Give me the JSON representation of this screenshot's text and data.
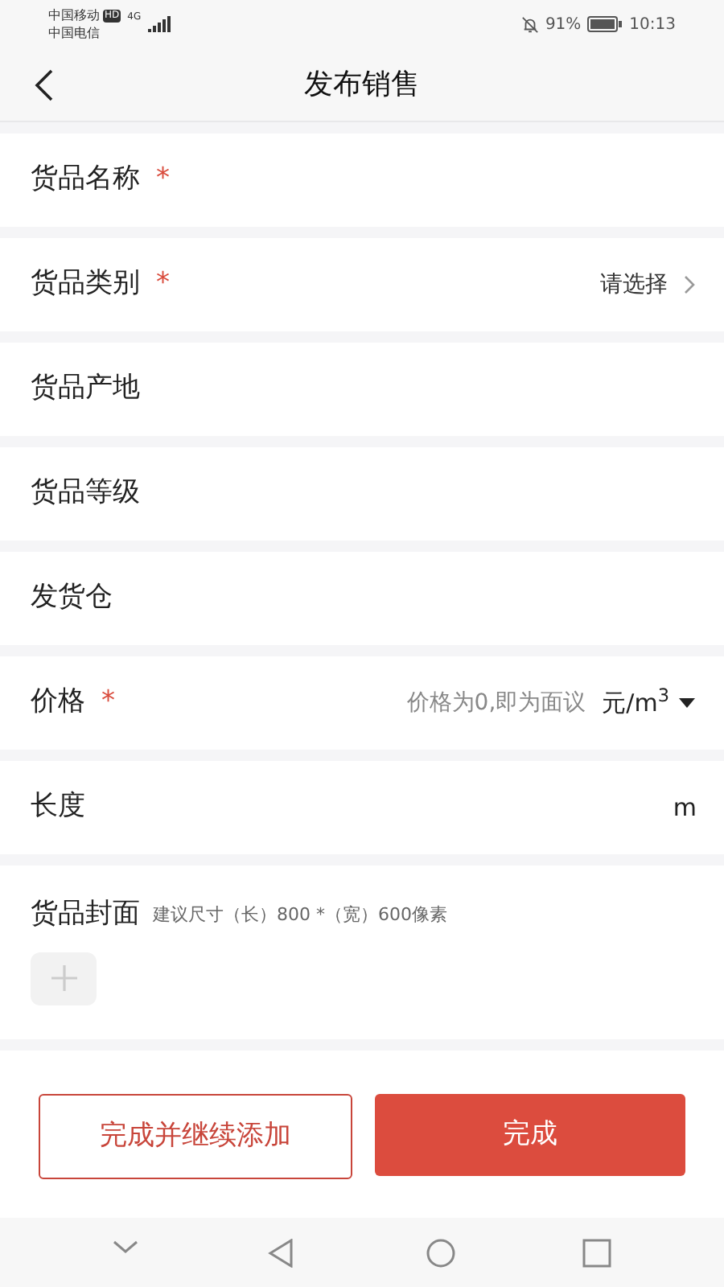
{
  "status_bar": {
    "carrier_1": "中国移动",
    "hd_badge": "HD",
    "network": "4G",
    "carrier_2": "中国电信",
    "battery": "91%",
    "time": "10:13"
  },
  "header": {
    "title": "发布销售"
  },
  "required_mark": "*",
  "fields": [
    {
      "kind": "text",
      "label": "货品名称",
      "required": true
    },
    {
      "kind": "select",
      "label": "货品类别",
      "required": true,
      "value": "请选择"
    },
    {
      "kind": "text",
      "label": "货品产地",
      "required": false
    },
    {
      "kind": "text",
      "label": "货品等级",
      "required": false
    },
    {
      "kind": "text",
      "label": "发货仓",
      "required": false
    },
    {
      "kind": "price",
      "label": "价格",
      "required": true,
      "placeholder": "价格为0,即为面议",
      "unit": "元/m$^{3}$"
    },
    {
      "kind": "unit",
      "label": "长度",
      "required": false,
      "unit": "m"
    }
  ],
  "cover": {
    "label": "货品封面",
    "hint": "建议尺寸（长）800 *（宽）600像素"
  },
  "buttons": {
    "secondary": "完成并继续添加",
    "primary": "完成"
  }
}
